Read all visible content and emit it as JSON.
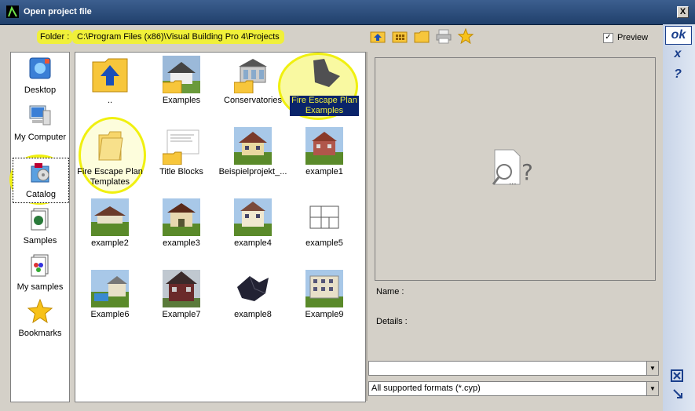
{
  "window": {
    "title": "Open project file",
    "close_label": "X"
  },
  "folder": {
    "label": "Folder :",
    "path": "C:\\Program Files (x86)\\Visual Building Pro 4\\Projects"
  },
  "toolbar": {
    "icons": [
      "folder-up-icon",
      "grid-folder-icon",
      "new-folder-icon",
      "print-icon",
      "star-icon"
    ]
  },
  "preview_toggle": {
    "label": "Preview",
    "checked": true
  },
  "sidebar": {
    "items": [
      {
        "label": "Desktop"
      },
      {
        "label": "My Computer"
      },
      {
        "label": "Catalog"
      },
      {
        "label": "Samples"
      },
      {
        "label": "My samples"
      },
      {
        "label": "Bookmarks"
      }
    ]
  },
  "files": [
    {
      "label": "..",
      "kind": "up"
    },
    {
      "label": "Examples",
      "kind": "house-folder"
    },
    {
      "label": "Conservatories",
      "kind": "house-folder"
    },
    {
      "label": "Fire Escape Plan Examples",
      "kind": "fire-folder",
      "selected": true
    },
    {
      "label": "Fire Escape Plan Templates",
      "kind": "folder"
    },
    {
      "label": "Title Blocks",
      "kind": "doc-folder"
    },
    {
      "label": "Beispielprojekt_...",
      "kind": "house"
    },
    {
      "label": "example1",
      "kind": "house"
    },
    {
      "label": "example2",
      "kind": "house"
    },
    {
      "label": "example3",
      "kind": "house"
    },
    {
      "label": "example4",
      "kind": "house"
    },
    {
      "label": "example5",
      "kind": "plan"
    },
    {
      "label": "Example6",
      "kind": "house"
    },
    {
      "label": "Example7",
      "kind": "house"
    },
    {
      "label": "example8",
      "kind": "dark"
    },
    {
      "label": "Example9",
      "kind": "house"
    }
  ],
  "details": {
    "name_label": "Name :",
    "details_label": "Details :"
  },
  "filters": {
    "search_value": "",
    "format_value": "All supported formats (*.cyp)"
  },
  "right_buttons": {
    "ok": "ok",
    "cancel": "x",
    "help": "?"
  },
  "colors": {
    "title_bar": "#20406b",
    "highlight": "#f0f03a",
    "selection": "#0a246a"
  }
}
